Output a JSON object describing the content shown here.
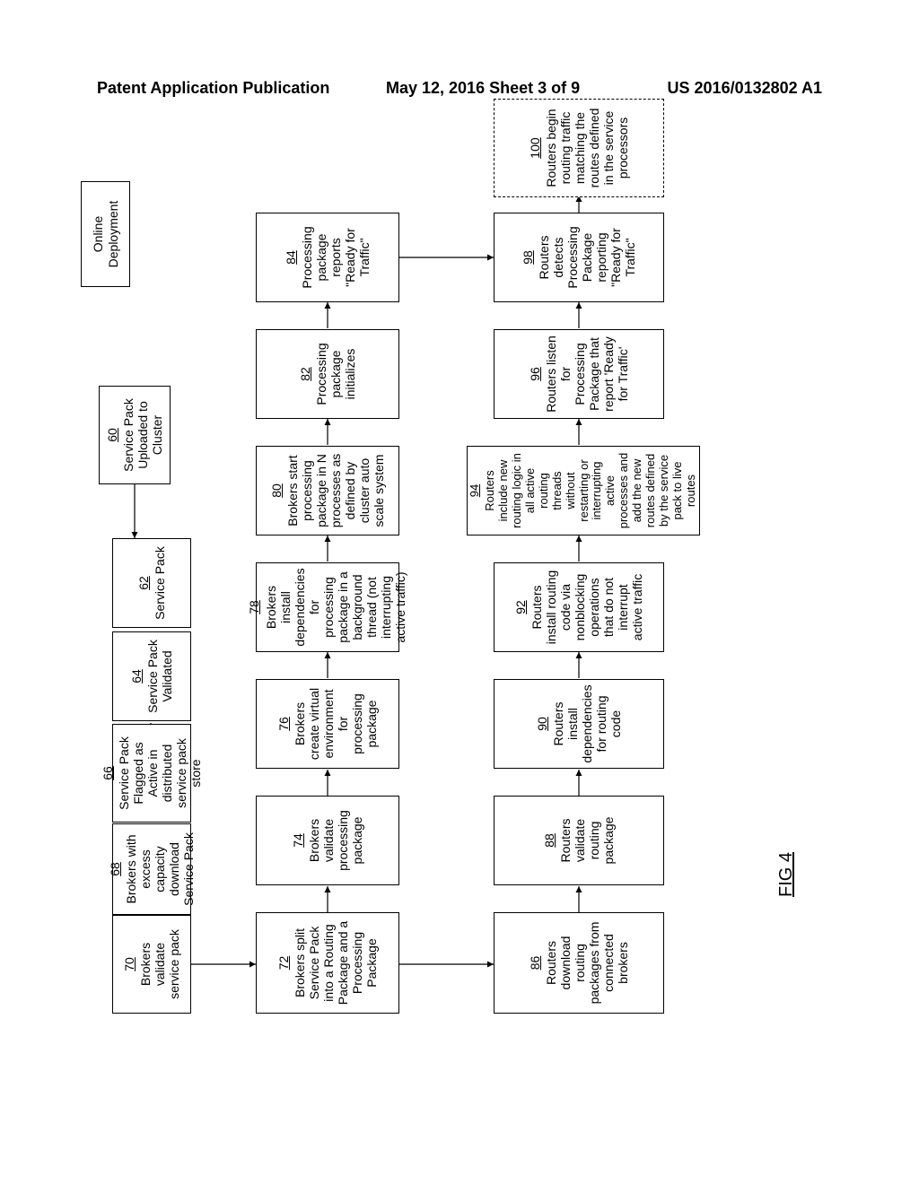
{
  "header": {
    "left": "Patent Application Publication",
    "center": "May 12, 2016  Sheet 3 of 9",
    "right": "US 2016/0132802 A1"
  },
  "figure_label": "FIG 4",
  "online_deployment": "Online Deployment",
  "boxes": {
    "b60": {
      "num": "60",
      "text": "Service Pack Uploaded to Cluster"
    },
    "b62": {
      "num": "62",
      "text": "Service Pack"
    },
    "b64": {
      "num": "64",
      "text": "Service Pack Validated"
    },
    "b66": {
      "num": "66",
      "text": "Service Pack Flagged as Active in distributed service pack store"
    },
    "b68": {
      "num": "68",
      "text": "Brokers with excess capacity download Service Pack"
    },
    "b70": {
      "num": "70",
      "text": "Brokers validate service pack"
    },
    "b72": {
      "num": "72",
      "text": "Brokers split Service Pack into a Routing Package and a Processing Package"
    },
    "b74": {
      "num": "74",
      "text": "Brokers validate processing package"
    },
    "b76": {
      "num": "76",
      "text": "Brokers create virtual environment for processing package"
    },
    "b78": {
      "num": "78",
      "text": "Brokers install dependencies for processing package in a background thread (not interrupting active traffic)"
    },
    "b80": {
      "num": "80",
      "text": "Brokers start processing package in N processes as defined by cluster auto scale system"
    },
    "b82": {
      "num": "82",
      "text": "Processing package initializes"
    },
    "b84": {
      "num": "84",
      "text": "Processing package reports \"Ready for Traffic\""
    },
    "b86": {
      "num": "86",
      "text": "Routers download routing packages from connected brokers"
    },
    "b88": {
      "num": "88",
      "text": "Routers validate routing package"
    },
    "b90": {
      "num": "90",
      "text": "Routers install dependencies for routing code"
    },
    "b92": {
      "num": "92",
      "text": "Routers install routing code via nonblocking operations that do not interrupt active traffic"
    },
    "b94": {
      "num": "94",
      "text": "Routers include new routing logic in all active routing threads without restarting or interrupting active processes and add the new routes defined by the service pack to live routes"
    },
    "b96": {
      "num": "96",
      "text": "Routers listen for Processing Package that report 'Ready for Traffic'"
    },
    "b98": {
      "num": "98",
      "text": "Routers detects Processing Package reporting \"Ready for Traffic\""
    },
    "b100": {
      "num": "100",
      "text": "Routers begin routing traffic matching the routes defined in the service processors"
    }
  }
}
